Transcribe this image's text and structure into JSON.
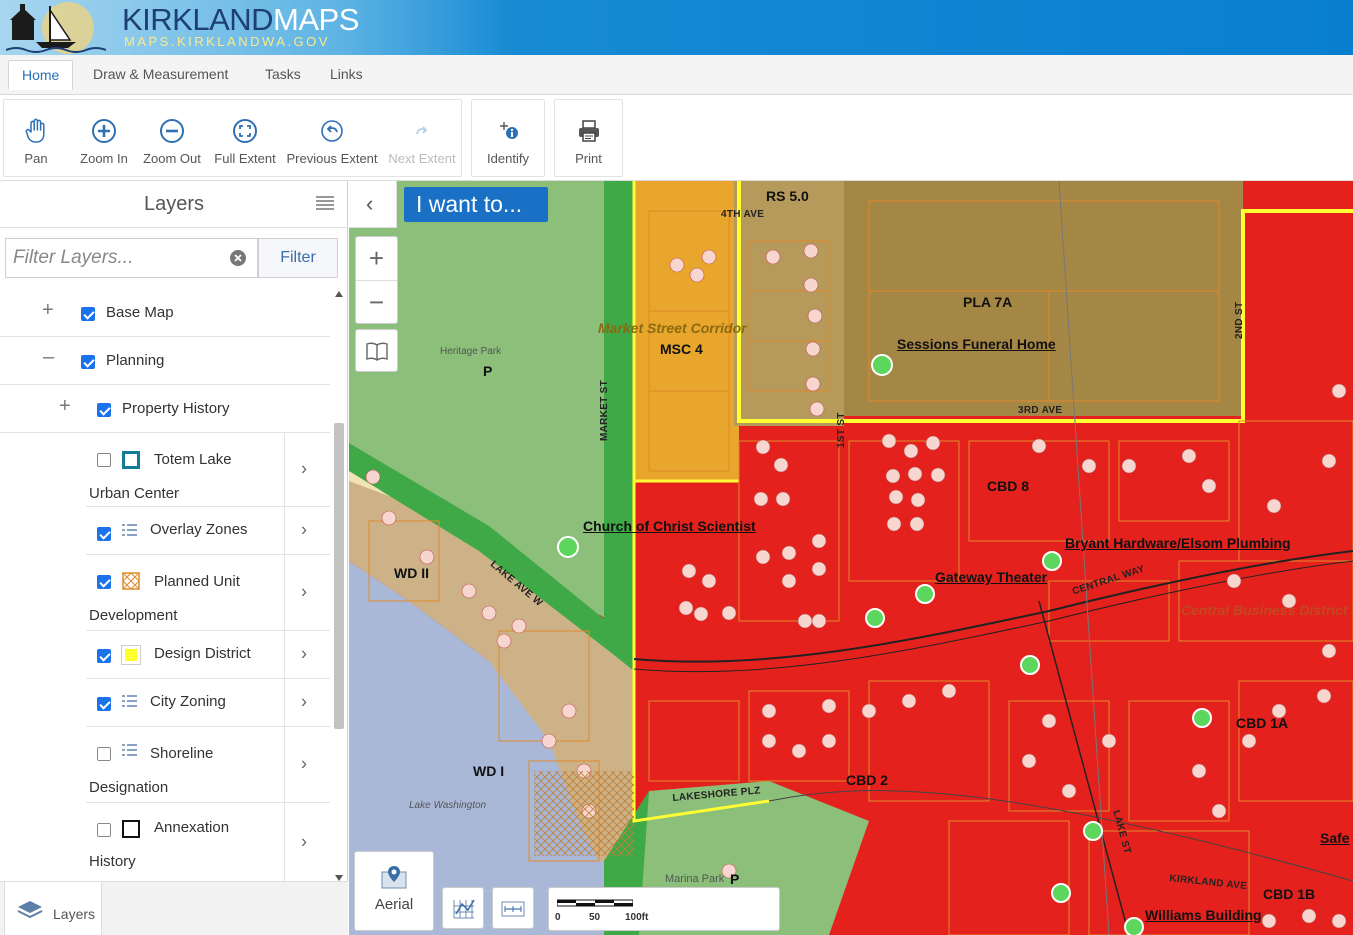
{
  "banner": {
    "title_part1": "KIRKLAND",
    "title_part2": "MAPS",
    "subtitle": "MAPS.KIRKLANDWA.GOV"
  },
  "tabs": [
    {
      "label": "Home",
      "active": true
    },
    {
      "label": "Draw & Measurement",
      "active": false
    },
    {
      "label": "Tasks",
      "active": false
    },
    {
      "label": "Links",
      "active": false
    }
  ],
  "toolbar": {
    "navigation": [
      {
        "label": "Pan",
        "icon": "hand-icon",
        "enabled": true
      },
      {
        "label": "Zoom In",
        "icon": "zoom-in-icon",
        "enabled": true
      },
      {
        "label": "Zoom Out",
        "icon": "zoom-out-icon",
        "enabled": true
      },
      {
        "label": "Full Extent",
        "icon": "full-extent-icon",
        "enabled": true
      },
      {
        "label": "Previous Extent",
        "icon": "back-arrow-icon",
        "enabled": true
      },
      {
        "label": "Next Extent",
        "icon": "forward-arrow-icon",
        "enabled": false
      }
    ],
    "identify": {
      "label": "Identify",
      "icon": "identify-icon"
    },
    "print": {
      "label": "Print",
      "icon": "printer-icon"
    }
  },
  "layers_panel": {
    "title": "Layers",
    "filter_placeholder": "Filter Layers...",
    "filter_button": "Filter",
    "items": [
      {
        "label": "Base Map",
        "checked": true,
        "expander": "+"
      },
      {
        "label": "Planning",
        "checked": true,
        "expander": "–"
      },
      {
        "label": "Property History",
        "checked": true,
        "expander": "+"
      },
      {
        "label_line1": "Totem Lake",
        "label_line2": "Urban Center",
        "checked": false,
        "legend": "teal-square"
      },
      {
        "label": "Overlay Zones",
        "checked": true,
        "legend": "list-legend"
      },
      {
        "label_line1": "Planned Unit",
        "label_line2": "Development",
        "checked": true,
        "legend": "hatched-orange"
      },
      {
        "label": "Design District",
        "checked": true,
        "legend": "yellow-square"
      },
      {
        "label": "City Zoning",
        "checked": true,
        "legend": "list-legend"
      },
      {
        "label_line1": "Shoreline",
        "label_line2": "Designation",
        "checked": false,
        "legend": "list-legend"
      },
      {
        "label_line1": "Annexation",
        "label_line2": "History",
        "checked": false,
        "legend": "black-outline-square"
      }
    ],
    "bottom_tab": "Layers"
  },
  "map": {
    "i_want_to": "I want to...",
    "aerial_label": "Aerial",
    "scale_labels": [
      "0",
      "50",
      "100ft"
    ],
    "colors": {
      "commercial": "#e5211d",
      "park": "#8cc07a",
      "market": "#e9a62c",
      "plan": "#a58745",
      "water": "#aab8d8",
      "waterfront": "#c9ad7f"
    },
    "zone_labels": [
      "RS 5.0",
      "PLA 7A",
      "MSC 4",
      "P",
      "WD II",
      "WD I",
      "CBD 8",
      "CBD 1A",
      "CBD 2",
      "CBD 1B",
      "P"
    ],
    "street_labels": [
      "4TH AVE",
      "3RD AVE",
      "MARKET ST",
      "1ST ST",
      "2ND ST",
      "LAKE AVE W",
      "CENTRAL WAY",
      "LAKESHORE PLZ",
      "LAKE ST",
      "KIRKLAND AVE"
    ],
    "poi_labels": [
      "Sessions Funeral Home",
      "Church of Christ Scientist",
      "Bryant Hardware/Elsom Plumbing",
      "Gateway Theater",
      "Williams Building",
      "Safe"
    ],
    "other_labels": [
      "Heritage Park",
      "Lake Washington",
      "Marina Park",
      "Market Street Corridor",
      "Central Business District"
    ]
  }
}
